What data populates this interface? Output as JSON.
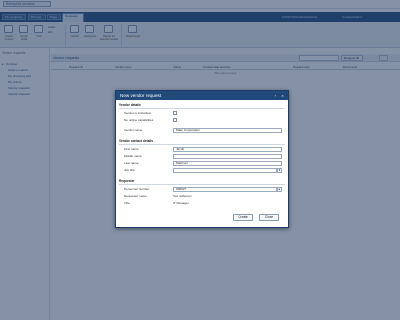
{
  "site": {
    "button_label": "Enterprise services"
  },
  "tabs": [
    {
      "label": "My company",
      "active": false
    },
    {
      "label": "Browse",
      "active": false
    },
    {
      "label": "Page",
      "active": false
    },
    {
      "label": "Requests",
      "active": true
    }
  ],
  "user": {
    "company": "CONTOSO/Administrators",
    "account": "Contoso\\Admin"
  },
  "ribbon": {
    "buttons": [
      {
        "label": "Vendor request"
      },
      {
        "label": "Vendor detail"
      },
      {
        "label": "View"
      },
      {
        "label": "Vendor"
      },
      {
        "label": "Categories"
      },
      {
        "label": "Report for selected vendor"
      },
      {
        "label": "Attachments"
      }
    ],
    "small_buttons": [
      {
        "label": "Delete"
      },
      {
        "label": "Edit"
      }
    ],
    "groups": [
      {
        "label": ""
      },
      {
        "label": ""
      },
      {
        "label": ""
      }
    ]
  },
  "leftnav": {
    "header": "Vendor requests",
    "caret": "▸",
    "items": [
      {
        "label": "Contoso"
      },
      {
        "label": "Order products"
      },
      {
        "label": "My shopping cart"
      },
      {
        "label": "My orders"
      },
      {
        "label": "Vendor requests"
      },
      {
        "label": "Vendor requests"
      }
    ]
  },
  "grid": {
    "title": "Vendor requests",
    "toolbar_label": "Request ID",
    "columns": [
      {
        "label": "Request ID"
      },
      {
        "label": "Vendor name"
      },
      {
        "label": "Status"
      },
      {
        "label": "Created date and time"
      },
      {
        "label": "Request type"
      },
      {
        "label": "Documents"
      }
    ],
    "empty_text": "This grid is empty."
  },
  "dialog": {
    "title": "New vendor request",
    "controls": {
      "maximize": "▫",
      "close": "×"
    },
    "sections": {
      "vendor_details": "Vendor details",
      "vendor_contact": "Vendor contact details",
      "requester": "Requester"
    },
    "fields": {
      "is_individual": {
        "label": "Vendor is individual",
        "checked": false
      },
      "no_online": {
        "label": "No online capabilities",
        "checked": false
      },
      "vendor_name": {
        "label": "Vendor name",
        "value": "Mate Corporation"
      },
      "first_name": {
        "label": "First name",
        "value": "Jacob"
      },
      "middle_name": {
        "label": "Middle name",
        "value": ""
      },
      "last_name": {
        "label": "Last name",
        "value": "Martinez"
      },
      "job_title": {
        "label": "Job title",
        "value": ""
      },
      "personnel_number": {
        "label": "Personnel number",
        "value": "000027"
      },
      "requester_name": {
        "label": "Requester name",
        "value": "Ted Jefferson"
      },
      "title": {
        "label": "Title",
        "value": "IT Manager"
      }
    },
    "buttons": {
      "create": "Create",
      "close": "Close"
    }
  },
  "colors": {
    "header": "#21497a",
    "overlay": "rgba(32,55,92,0.55)"
  }
}
